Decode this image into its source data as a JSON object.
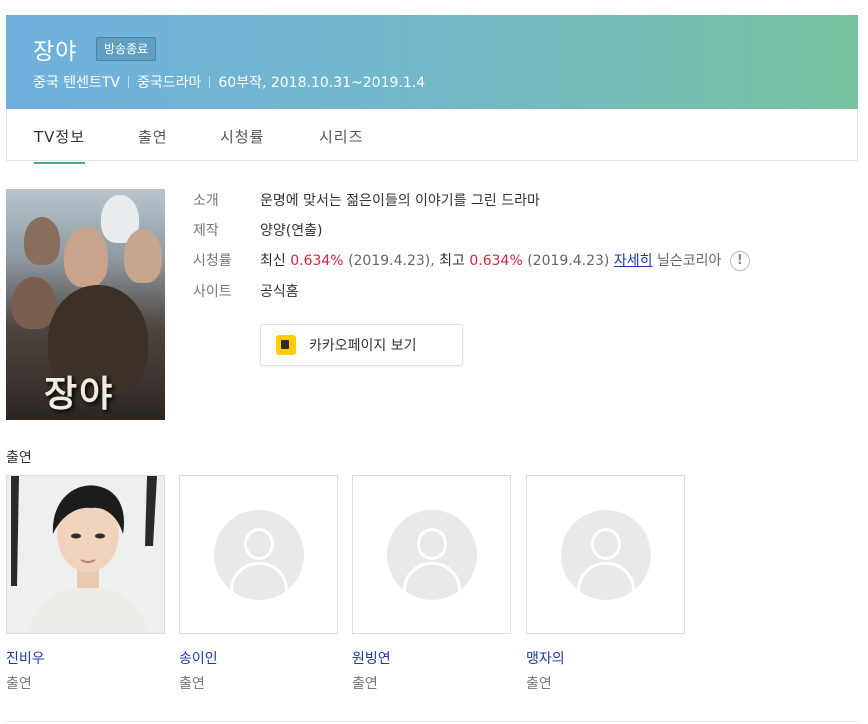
{
  "header": {
    "title": "장야",
    "badge": "방송종료",
    "network": "중국 텐센트TV",
    "genre": "중국드라마",
    "episodes_dates": "60부작, 2018.10.31~2019.1.4"
  },
  "tabs": [
    "TV정보",
    "출연",
    "시청률",
    "시리즈"
  ],
  "poster": {
    "logo_text": "장야"
  },
  "info": {
    "synopsis_label": "소개",
    "synopsis": "운명에 맞서는 젊은이들의 이야기를 그린 드라마",
    "production_label": "제작",
    "production": "양양(연출)",
    "ratings_label": "시청률",
    "ratings_latest_label": "최신",
    "ratings_latest_value": "0.634%",
    "ratings_latest_date": "(2019.4.23),",
    "ratings_best_label": "최고",
    "ratings_best_value": "0.634%",
    "ratings_best_date": "(2019.4.23)",
    "ratings_detail_link": "자세히",
    "ratings_source": "닐슨코리아",
    "ratings_info_icon": "!",
    "site_label": "사이트",
    "site_link": "공식홈"
  },
  "kakao_button": {
    "label": "카카오페이지 보기",
    "accent": "#ffcd00"
  },
  "cast": {
    "heading": "출연",
    "members": [
      {
        "name": "진비우",
        "role": "출연"
      },
      {
        "name": "송이인",
        "role": "출연"
      },
      {
        "name": "원빙연",
        "role": "출연"
      },
      {
        "name": "맹자의",
        "role": "출연"
      }
    ]
  },
  "colors": {
    "banner_start": "#6fb0de",
    "banner_end": "#77c3a0",
    "rating_red": "#d5253b",
    "link_blue": "#1d39a4",
    "tab_underline": "#4aa3a0"
  }
}
